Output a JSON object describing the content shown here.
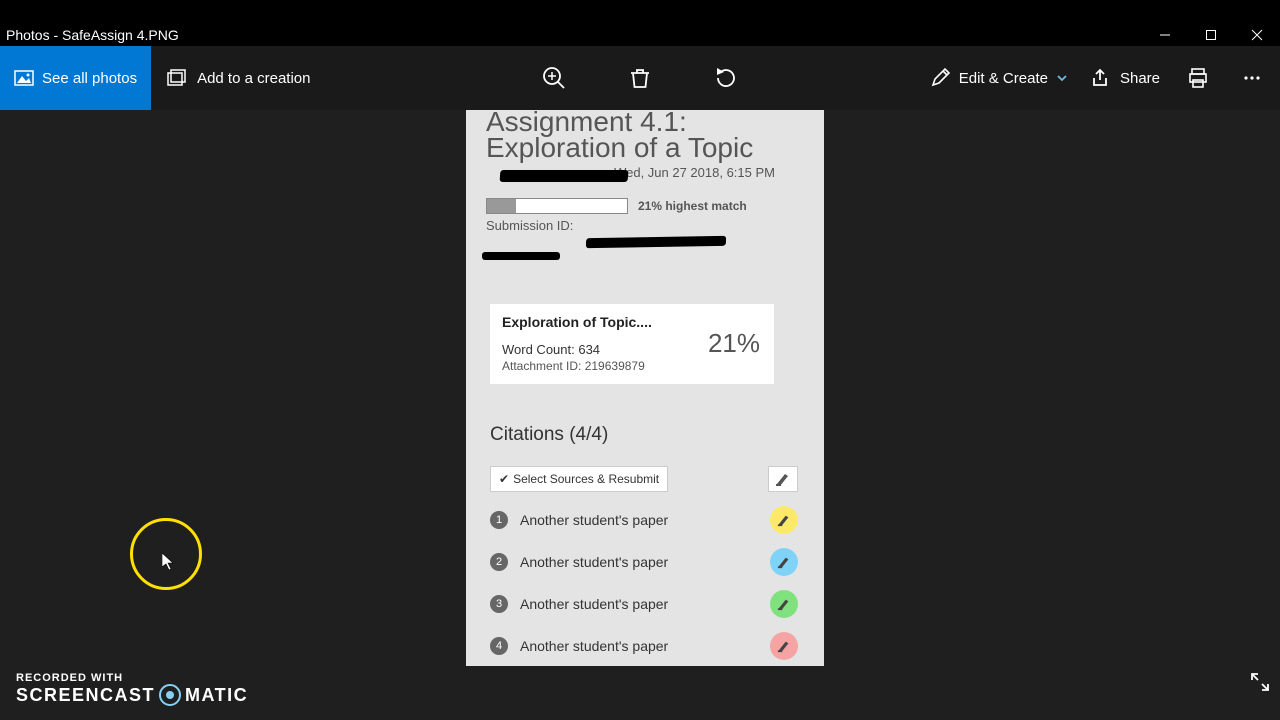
{
  "window": {
    "title": "Photos - SafeAssign 4.PNG"
  },
  "toolbar": {
    "see_all": "See all photos",
    "add_creation": "Add to a creation",
    "edit_create": "Edit & Create",
    "share": "Share"
  },
  "document": {
    "title_line1": "Assignment 4.1:",
    "title_line2": "Exploration of a Topic",
    "submitted_on": "on Wed, Jun 27 2018, 6:15 PM",
    "highest_match": "21% highest match",
    "submission_id_label": "Submission ID:",
    "box": {
      "title": "Exploration of Topic....",
      "word_count": "Word Count: 634",
      "attachment": "Attachment ID: 219639879",
      "percent": "21%"
    },
    "citations_header": "Citations (4/4)",
    "select_sources": "Select Sources & Resubmit",
    "citations": [
      {
        "n": "1",
        "label": "Another student's paper",
        "color": "#fce96a"
      },
      {
        "n": "2",
        "label": "Another student's paper",
        "color": "#7fd3f7"
      },
      {
        "n": "3",
        "label": "Another student's paper",
        "color": "#80e27e"
      },
      {
        "n": "4",
        "label": "Another student's paper",
        "color": "#f5a3a3"
      }
    ]
  },
  "watermark": {
    "line1": "RECORDED WITH",
    "line2a": "SCREENCAST",
    "line2b": "MATIC"
  }
}
